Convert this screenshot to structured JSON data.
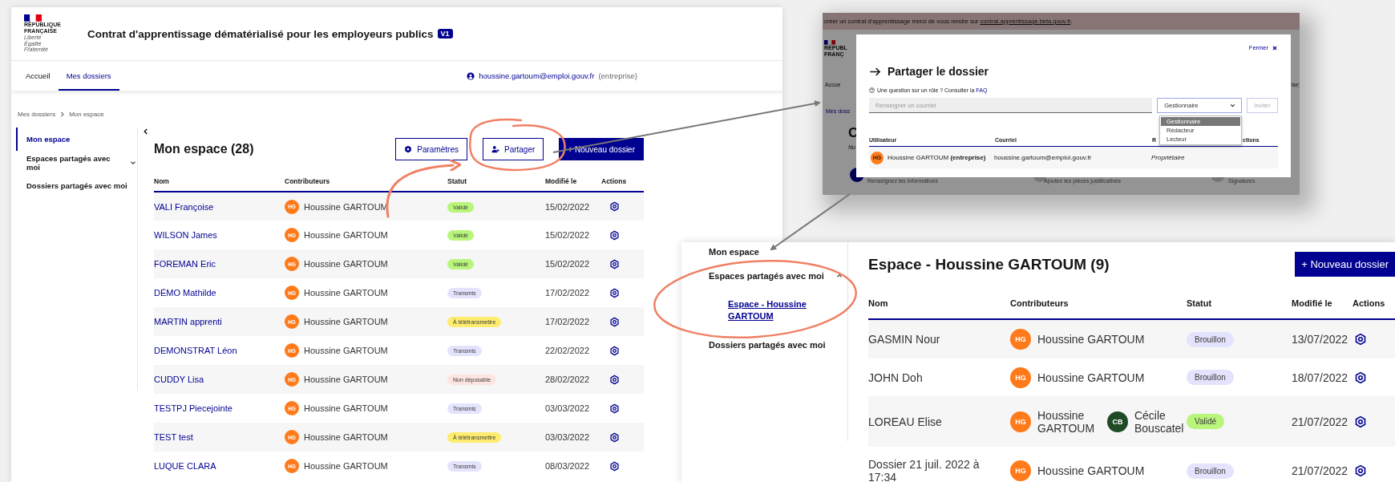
{
  "main_window": {
    "logo": {
      "lines": [
        "RÉPUBLIQUE",
        "FRANÇAISE"
      ],
      "motto": [
        "Liberté",
        "Égalité",
        "Fraternité"
      ]
    },
    "title": "Contrat d'apprentissage dématérialisé pour les employeurs publics",
    "badge": "V1",
    "nav": [
      {
        "label": "Accueil",
        "selected": false
      },
      {
        "label": "Mes dossiers",
        "selected": true
      }
    ],
    "user": {
      "email": "houssine.gartoum@emploi.gouv.fr",
      "role": "(entreprise)"
    },
    "breadcrumb": [
      "Mes dossiers",
      "Mon espace"
    ],
    "sidebar": [
      {
        "kind": "link",
        "label": "Mon espace",
        "selected": true
      },
      {
        "kind": "group",
        "label": "Espaces partagés avec moi",
        "selected": false,
        "expanded": false
      },
      {
        "kind": "link",
        "label": "Dossiers partagés avec moi",
        "selected": false
      }
    ],
    "heading": "Mon espace (28)",
    "actions": [
      {
        "kind": "settings",
        "label": "Paramètres"
      },
      {
        "kind": "share",
        "label": "Partager"
      },
      {
        "kind": "primary",
        "label": "+ Nouveau dossier"
      }
    ],
    "table": {
      "columns": [
        "Nom",
        "Contributeurs",
        "Statut",
        "Modifié le",
        "Actions"
      ],
      "rows": [
        {
          "name": "VALI Françoise",
          "contributors": [
            {
              "initials": "HG",
              "name": "Houssine GARTOUM",
              "color": "#ff7a1a"
            }
          ],
          "status": {
            "label": "Validé",
            "color": "#b8f57a"
          },
          "modified": "15/02/2022"
        },
        {
          "name": "WILSON James",
          "contributors": [
            {
              "initials": "HG",
              "name": "Houssine GARTOUM",
              "color": "#ff7a1a"
            }
          ],
          "status": {
            "label": "Validé",
            "color": "#b8f57a"
          },
          "modified": "15/02/2022"
        },
        {
          "name": "FOREMAN Eric",
          "contributors": [
            {
              "initials": "HG",
              "name": "Houssine GARTOUM",
              "color": "#ff7a1a"
            }
          ],
          "status": {
            "label": "Validé",
            "color": "#b8f57a"
          },
          "modified": "15/02/2022"
        },
        {
          "name": "DÉMO Mathilde",
          "contributors": [
            {
              "initials": "HG",
              "name": "Houssine GARTOUM",
              "color": "#ff7a1a"
            }
          ],
          "status": {
            "label": "Transmis",
            "color": "#e3e3fd"
          },
          "modified": "17/02/2022"
        },
        {
          "name": "MARTIN apprenti",
          "contributors": [
            {
              "initials": "HG",
              "name": "Houssine GARTOUM",
              "color": "#ff7a1a"
            }
          ],
          "status": {
            "label": "À télétransmettre",
            "color": "#feec6f"
          },
          "modified": "17/02/2022"
        },
        {
          "name": "DEMONSTRAT Léon",
          "contributors": [
            {
              "initials": "HG",
              "name": "Houssine GARTOUM",
              "color": "#ff7a1a"
            }
          ],
          "status": {
            "label": "Transmis",
            "color": "#e3e3fd"
          },
          "modified": "22/02/2022"
        },
        {
          "name": "CUDDY Lisa",
          "contributors": [
            {
              "initials": "HG",
              "name": "Houssine GARTOUM",
              "color": "#ff7a1a"
            }
          ],
          "status": {
            "label": "Non déposable",
            "color": "#fee4e0"
          },
          "modified": "28/02/2022"
        },
        {
          "name": "TESTPJ Piecejointe",
          "contributors": [
            {
              "initials": "HG",
              "name": "Houssine GARTOUM",
              "color": "#ff7a1a"
            }
          ],
          "status": {
            "label": "Transmis",
            "color": "#e3e3fd"
          },
          "modified": "03/03/2022"
        },
        {
          "name": "TEST test",
          "contributors": [
            {
              "initials": "HG",
              "name": "Houssine GARTOUM",
              "color": "#ff7a1a"
            }
          ],
          "status": {
            "label": "À télétransmettre",
            "color": "#feec6f"
          },
          "modified": "03/03/2022"
        },
        {
          "name": "LUQUE CLARA",
          "contributors": [
            {
              "initials": "HG",
              "name": "Houssine GARTOUM",
              "color": "#ff7a1a"
            }
          ],
          "status": {
            "label": "Transmis",
            "color": "#e3e3fd"
          },
          "modified": "08/03/2022"
        }
      ]
    }
  },
  "share_dialog": {
    "background": {
      "banner": {
        "text": "créer un contrat d'apprentissage merci de vous rendre sur",
        "link": "contrat.apprentissage.beta.gouv.fr",
        "suffix": "."
      },
      "logo_lines": [
        "RÉPUBL",
        "FRANÇ"
      ],
      "nav_fragment": "Accue",
      "user_fragment": "ise)",
      "breadcrumb_fragment": "Mes doss",
      "heading_fragment": "C",
      "subtitle_fragment": "Nu",
      "steps": [
        {
          "label": "Renseignez les informations",
          "selected": true
        },
        {
          "label": "Ajoutez les pièces justificatives",
          "selected": false
        },
        {
          "label": "Signatures",
          "selected": false
        }
      ]
    },
    "close": "Fermer",
    "title": "Partager le dossier",
    "help": {
      "text": "Une question sur un rôle ? Consulter la",
      "link": "FAQ"
    },
    "email_field": {
      "placeholder": "Renseigner un courriel"
    },
    "role_select": {
      "value": "Gestionnaire",
      "open": true,
      "options": [
        {
          "label": "Gestionnaire",
          "selected": true
        },
        {
          "label": "Rédacteur",
          "selected": false
        },
        {
          "label": "Lecteur",
          "selected": false
        }
      ]
    },
    "invite_button": {
      "label": "Inviter",
      "disabled": true
    },
    "table": {
      "columns": [
        "Utilisateur",
        "Courriel",
        "R",
        "ctions"
      ],
      "rows": [
        {
          "initials": "HG",
          "name": "Houssine GARTOUM",
          "tag": "(entreprise)",
          "email": "houssine.gartoum@emploi.gouv.fr",
          "role": "Propriétaire"
        }
      ]
    }
  },
  "shared_space": {
    "sidebar": [
      {
        "kind": "link",
        "label": "Mon espace",
        "selected": false
      },
      {
        "kind": "group",
        "label": "Espaces partagés avec moi",
        "selected": false,
        "expanded": true,
        "children": [
          {
            "kind": "link",
            "label": "Espace - Houssine GARTOUM",
            "selected": true
          }
        ]
      },
      {
        "kind": "link",
        "label": "Dossiers partagés avec moi",
        "selected": false
      }
    ],
    "heading": "Espace - Houssine GARTOUM (9)",
    "new_button": "+ Nouveau dossier",
    "table": {
      "columns": [
        "Nom",
        "Contributeurs",
        "Statut",
        "Modifié le",
        "Actions"
      ],
      "rows": [
        {
          "name": "GASMIN Nour",
          "contributors": [
            {
              "initials": "HG",
              "name": "Houssine GARTOUM",
              "color": "#ff7a1a"
            }
          ],
          "status": {
            "label": "Brouillon",
            "color": "#e3e3fd"
          },
          "modified": "13/07/2022"
        },
        {
          "name": "JOHN Doh",
          "contributors": [
            {
              "initials": "HG",
              "name": "Houssine GARTOUM",
              "color": "#ff7a1a"
            }
          ],
          "status": {
            "label": "Brouillon",
            "color": "#e3e3fd"
          },
          "modified": "18/07/2022"
        },
        {
          "name": "LOREAU Elise",
          "contributors": [
            {
              "initials": "HG",
              "name": "Houssine GARTOUM",
              "color": "#ff7a1a"
            },
            {
              "initials": "CB",
              "name": "Cécile Bouscatel",
              "color": "#1f4a26"
            }
          ],
          "status": {
            "label": "Validé",
            "color": "#b8f57a"
          },
          "modified": "21/07/2022"
        },
        {
          "name": "Dossier 21 juil. 2022 à 17:34",
          "contributors": [
            {
              "initials": "HG",
              "name": "Houssine GARTOUM",
              "color": "#ff7a1a"
            }
          ],
          "status": {
            "label": "Brouillon",
            "color": "#e3e3fd"
          },
          "modified": "21/07/2022"
        }
      ]
    }
  }
}
